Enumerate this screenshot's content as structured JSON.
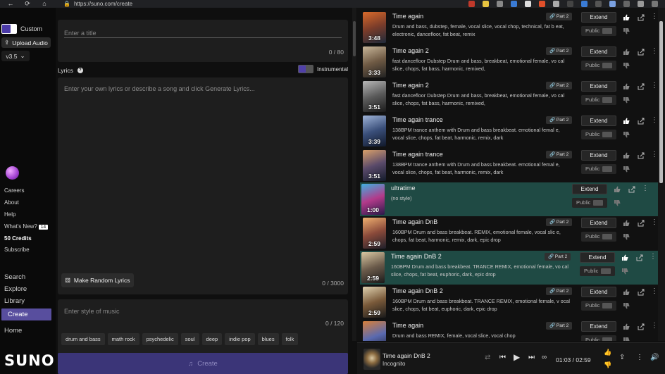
{
  "browser": {
    "url": "https://suno.com/create"
  },
  "sidebar": {
    "custom_label": "Custom",
    "upload_label": "Upload Audio",
    "version": "v3.5",
    "links": [
      "Careers",
      "About",
      "Help",
      "What's New?"
    ],
    "whats_new_badge": "14",
    "credits": "50 Credits",
    "subscribe": "Subscribe",
    "nav": [
      "Search",
      "Explore",
      "Library",
      "Create",
      "Home"
    ],
    "logo": "SUNO"
  },
  "form": {
    "title_placeholder": "Enter a title",
    "title_counter": "0 / 80",
    "lyrics_label": "Lyrics",
    "instrumental_label": "Instrumental",
    "lyrics_placeholder": "Enter your own lyrics or describe a song and click Generate Lyrics...",
    "random_lyrics_label": "Make Random Lyrics",
    "lyrics_counter": "0 / 3000",
    "style_placeholder": "Enter style of music",
    "style_counter": "0 / 120",
    "style_tags": [
      "drum and bass",
      "math rock",
      "psychedelic",
      "soul",
      "deep",
      "indie pop",
      "blues",
      "folk"
    ],
    "create_label": "Create"
  },
  "songs": [
    {
      "title": "Time again",
      "desc": "Drum and bass, dubstep, female, vocal slice, vocal chop, technical, fat b eat, electronic, dancefloor, fat beat, remix",
      "duration": "3:48",
      "part": "Part 2",
      "liked": true,
      "active": false,
      "thumb_colors": [
        "#d96a2b",
        "#7a3c2a",
        "#1f2a3a"
      ]
    },
    {
      "title": "Time again 2",
      "desc": "fast dancefloor Dubstep Drum and bass, breakbeat, emotional female, vo cal slice, chops, fat bass, harmonic, remixed,",
      "duration": "3:33",
      "part": "Part 2",
      "liked": false,
      "active": false,
      "thumb_colors": [
        "#c9b79a",
        "#6f5a44",
        "#222"
      ]
    },
    {
      "title": "Time again 2",
      "desc": "fast dancefloor Dubstep Drum and bass, breakbeat, emotional female, vo cal slice, chops, fat bass, harmonic, remixed,",
      "duration": "3:51",
      "part": "Part 2",
      "liked": false,
      "active": false,
      "thumb_colors": [
        "#b8b8b8",
        "#5a5a5a",
        "#1a1a1a"
      ]
    },
    {
      "title": "Time again trance",
      "desc": "138BPM trance anthem with Drum and bass breakbeat. emotional femal e, vocal slice, chops, fat beat, harmonic, remix, dark",
      "duration": "3:39",
      "part": "Part 2",
      "liked": true,
      "active": false,
      "thumb_colors": [
        "#9fb4d8",
        "#3a4f7a",
        "#10182a"
      ]
    },
    {
      "title": "Time again trance",
      "desc": "138BPM trance anthem with Drum and bass breakbeat. emotional femal e, vocal slice, chops, fat beat, harmonic, remix, dark",
      "duration": "3:51",
      "part": "Part 2",
      "liked": false,
      "active": false,
      "thumb_colors": [
        "#d8a06a",
        "#5a4a6a",
        "#121a2a"
      ]
    },
    {
      "title": "ultratime",
      "desc": "(no style)",
      "duration": "1:00",
      "part": "",
      "liked": false,
      "active": true,
      "thumb_colors": [
        "#3fb0e0",
        "#b23a8a",
        "#2a1a4a"
      ]
    },
    {
      "title": "Time again DnB",
      "desc": "160BPM Drum and bass breakbeat. REMIX, emotional female, vocal slic e, chops, fat beat, harmonic, remix, dark, epic drop",
      "duration": "2:59",
      "part": "Part 2",
      "liked": false,
      "active": false,
      "thumb_colors": [
        "#f0b070",
        "#8a4a3a",
        "#1f1f2a"
      ]
    },
    {
      "title": "Time again DnB 2",
      "desc": "160BPM Drum and bass breakbeat. TRANCE REMIX, emotional female, vo cal slice, chops, fat beat, euphoric, dark, epic drop",
      "duration": "2:59",
      "part": "Part 2",
      "liked": true,
      "active": true,
      "thumb_colors": [
        "#d9c8a3",
        "#6a5a4a",
        "#1a1a1a"
      ]
    },
    {
      "title": "Time again DnB 2",
      "desc": "160BPM Drum and bass breakbeat. TRANCE REMIX, emotional female, v ocal slice, chops, fat beat, euphoric, dark, epic drop",
      "duration": "2:59",
      "part": "Part 2",
      "liked": false,
      "active": false,
      "thumb_colors": [
        "#e0d2b0",
        "#7a5a3a",
        "#1a1a1a"
      ]
    },
    {
      "title": "Time again",
      "desc": "Drum and bass REMIX, female, vocal slice, vocal chop",
      "duration": "",
      "part": "Part 2",
      "liked": false,
      "active": false,
      "thumb_colors": [
        "#d9803a",
        "#5a6ab0",
        "#1a1a2a"
      ]
    }
  ],
  "song_ui": {
    "extend_label": "Extend",
    "public_label": "Public"
  },
  "player": {
    "title": "Time again DnB 2",
    "artist": "Incognito",
    "time": "01:03 / 02:59"
  },
  "colors": {
    "accent": "#584e9e",
    "active_row": "#1f4a44",
    "create_btn": "#3b3578"
  }
}
